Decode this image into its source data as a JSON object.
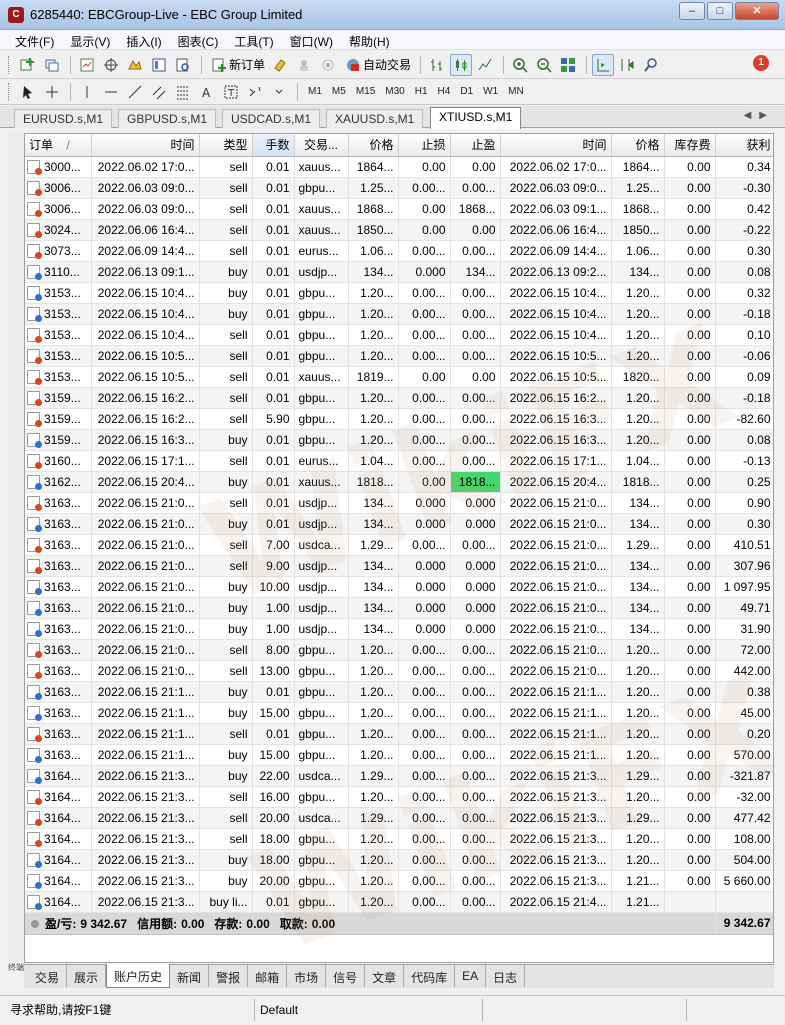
{
  "window": {
    "title": "6285440: EBCGroup-Live - EBC Group Limited",
    "app_icon": "mt4-icon",
    "controls": [
      "minimize",
      "maximize",
      "close"
    ]
  },
  "menu": [
    "文件(F)",
    "显示(V)",
    "插入(I)",
    "图表(C)",
    "工具(T)",
    "窗口(W)",
    "帮助(H)"
  ],
  "toolbar": {
    "new_order_label": "新订单",
    "auto_trade_label": "自动交易",
    "notification_count": "1",
    "timeframes": [
      "M1",
      "M5",
      "M15",
      "M30",
      "H1",
      "H4",
      "D1",
      "W1",
      "MN"
    ]
  },
  "chart_tabs": [
    {
      "label": "EURUSD.s,M1",
      "active": false
    },
    {
      "label": "GBPUSD.s,M1",
      "active": false
    },
    {
      "label": "USDCAD.s,M1",
      "active": false
    },
    {
      "label": "XAUUSD.s,M1",
      "active": false
    },
    {
      "label": "XTIUSD.s,M1",
      "active": true
    }
  ],
  "table": {
    "headers": [
      "订单",
      "/",
      "时间",
      "类型",
      "手数",
      "交易...",
      "价格",
      "止损",
      "止盈",
      "时间",
      "价格",
      "库存费",
      "获利"
    ],
    "rows": [
      [
        "3000...",
        "2022.06.02 17:0...",
        "sell",
        "0.01",
        "xauus...",
        "1864...",
        "0.00",
        "0.00",
        "2022.06.02 17:0...",
        "1864...",
        "0.00",
        "0.34"
      ],
      [
        "3006...",
        "2022.06.03 09:0...",
        "sell",
        "0.01",
        "gbpu...",
        "1.25...",
        "0.00...",
        "0.00...",
        "2022.06.03 09:0...",
        "1.25...",
        "0.00",
        "-0.30"
      ],
      [
        "3006...",
        "2022.06.03 09:0...",
        "sell",
        "0.01",
        "xauus...",
        "1868...",
        "0.00",
        "1868...",
        "2022.06.03 09:1...",
        "1868...",
        "0.00",
        "0.42"
      ],
      [
        "3024...",
        "2022.06.06 16:4...",
        "sell",
        "0.01",
        "xauus...",
        "1850...",
        "0.00",
        "0.00",
        "2022.06.06 16:4...",
        "1850...",
        "0.00",
        "-0.22"
      ],
      [
        "3073...",
        "2022.06.09 14:4...",
        "sell",
        "0.01",
        "eurus...",
        "1.06...",
        "0.00...",
        "0.00...",
        "2022.06.09 14:4...",
        "1.06...",
        "0.00",
        "0.30"
      ],
      [
        "3110...",
        "2022.06.13 09:1...",
        "buy",
        "0.01",
        "usdjp...",
        "134...",
        "0.000",
        "134...",
        "2022.06.13 09:2...",
        "134...",
        "0.00",
        "0.08"
      ],
      [
        "3153...",
        "2022.06.15 10:4...",
        "buy",
        "0.01",
        "gbpu...",
        "1.20...",
        "0.00...",
        "0.00...",
        "2022.06.15 10:4...",
        "1.20...",
        "0.00",
        "0.32"
      ],
      [
        "3153...",
        "2022.06.15 10:4...",
        "buy",
        "0.01",
        "gbpu...",
        "1.20...",
        "0.00...",
        "0.00...",
        "2022.06.15 10:4...",
        "1.20...",
        "0.00",
        "-0.18"
      ],
      [
        "3153...",
        "2022.06.15 10:4...",
        "sell",
        "0.01",
        "gbpu...",
        "1.20...",
        "0.00...",
        "0.00...",
        "2022.06.15 10:4...",
        "1.20...",
        "0.00",
        "0.10"
      ],
      [
        "3153...",
        "2022.06.15 10:5...",
        "sell",
        "0.01",
        "gbpu...",
        "1.20...",
        "0.00...",
        "0.00...",
        "2022.06.15 10:5...",
        "1.20...",
        "0.00",
        "-0.06"
      ],
      [
        "3153...",
        "2022.06.15 10:5...",
        "sell",
        "0.01",
        "xauus...",
        "1819...",
        "0.00",
        "0.00",
        "2022.06.15 10:5...",
        "1820...",
        "0.00",
        "0.09"
      ],
      [
        "3159...",
        "2022.06.15 16:2...",
        "sell",
        "0.01",
        "gbpu...",
        "1.20...",
        "0.00...",
        "0.00...",
        "2022.06.15 16:2...",
        "1.20...",
        "0.00",
        "-0.18"
      ],
      [
        "3159...",
        "2022.06.15 16:2...",
        "sell",
        "5.90",
        "gbpu...",
        "1.20...",
        "0.00...",
        "0.00...",
        "2022.06.15 16:3...",
        "1.20...",
        "0.00",
        "-82.60"
      ],
      [
        "3159...",
        "2022.06.15 16:3...",
        "buy",
        "0.01",
        "gbpu...",
        "1.20...",
        "0.00...",
        "0.00...",
        "2022.06.15 16:3...",
        "1.20...",
        "0.00",
        "0.08"
      ],
      [
        "3160...",
        "2022.06.15 17:1...",
        "sell",
        "0.01",
        "eurus...",
        "1.04...",
        "0.00...",
        "0.00...",
        "2022.06.15 17:1...",
        "1.04...",
        "0.00",
        "-0.13"
      ],
      [
        "3162...",
        "2022.06.15 20:4...",
        "buy",
        "0.01",
        "xauus...",
        "1818...",
        "0.00",
        "1818...",
        "2022.06.15 20:4...",
        "1818...",
        "0.00",
        "0.25"
      ],
      [
        "3163...",
        "2022.06.15 21:0...",
        "sell",
        "0.01",
        "usdjp...",
        "134...",
        "0.000",
        "0.000",
        "2022.06.15 21:0...",
        "134...",
        "0.00",
        "0.90"
      ],
      [
        "3163...",
        "2022.06.15 21:0...",
        "buy",
        "0.01",
        "usdjp...",
        "134...",
        "0.000",
        "0.000",
        "2022.06.15 21:0...",
        "134...",
        "0.00",
        "0.30"
      ],
      [
        "3163...",
        "2022.06.15 21:0...",
        "sell",
        "7.00",
        "usdca...",
        "1.29...",
        "0.00...",
        "0.00...",
        "2022.06.15 21:0...",
        "1.29...",
        "0.00",
        "410.51"
      ],
      [
        "3163...",
        "2022.06.15 21:0...",
        "sell",
        "9.00",
        "usdjp...",
        "134...",
        "0.000",
        "0.000",
        "2022.06.15 21:0...",
        "134...",
        "0.00",
        "307.96"
      ],
      [
        "3163...",
        "2022.06.15 21:0...",
        "buy",
        "10.00",
        "usdjp...",
        "134...",
        "0.000",
        "0.000",
        "2022.06.15 21:0...",
        "134...",
        "0.00",
        "1 097.95"
      ],
      [
        "3163...",
        "2022.06.15 21:0...",
        "buy",
        "1.00",
        "usdjp...",
        "134...",
        "0.000",
        "0.000",
        "2022.06.15 21:0...",
        "134...",
        "0.00",
        "49.71"
      ],
      [
        "3163...",
        "2022.06.15 21:0...",
        "buy",
        "1.00",
        "usdjp...",
        "134...",
        "0.000",
        "0.000",
        "2022.06.15 21:0...",
        "134...",
        "0.00",
        "31.90"
      ],
      [
        "3163...",
        "2022.06.15 21:0...",
        "sell",
        "8.00",
        "gbpu...",
        "1.20...",
        "0.00...",
        "0.00...",
        "2022.06.15 21:0...",
        "1.20...",
        "0.00",
        "72.00"
      ],
      [
        "3163...",
        "2022.06.15 21:0...",
        "sell",
        "13.00",
        "gbpu...",
        "1.20...",
        "0.00...",
        "0.00...",
        "2022.06.15 21:0...",
        "1.20...",
        "0.00",
        "442.00"
      ],
      [
        "3163...",
        "2022.06.15 21:1...",
        "buy",
        "0.01",
        "gbpu...",
        "1.20...",
        "0.00...",
        "0.00...",
        "2022.06.15 21:1...",
        "1.20...",
        "0.00",
        "0.38"
      ],
      [
        "3163...",
        "2022.06.15 21:1...",
        "buy",
        "15.00",
        "gbpu...",
        "1.20...",
        "0.00...",
        "0.00...",
        "2022.06.15 21:1...",
        "1.20...",
        "0.00",
        "45.00"
      ],
      [
        "3163...",
        "2022.06.15 21:1...",
        "sell",
        "0.01",
        "gbpu...",
        "1.20...",
        "0.00...",
        "0.00...",
        "2022.06.15 21:1...",
        "1.20...",
        "0.00",
        "0.20"
      ],
      [
        "3163...",
        "2022.06.15 21:1...",
        "buy",
        "15.00",
        "gbpu...",
        "1.20...",
        "0.00...",
        "0.00...",
        "2022.06.15 21:1...",
        "1.20...",
        "0.00",
        "570.00"
      ],
      [
        "3164...",
        "2022.06.15 21:3...",
        "buy",
        "22.00",
        "usdca...",
        "1.29...",
        "0.00...",
        "0.00...",
        "2022.06.15 21:3...",
        "1.29...",
        "0.00",
        "-321.87"
      ],
      [
        "3164...",
        "2022.06.15 21:3...",
        "sell",
        "16.00",
        "gbpu...",
        "1.20...",
        "0.00...",
        "0.00...",
        "2022.06.15 21:3...",
        "1.20...",
        "0.00",
        "-32.00"
      ],
      [
        "3164...",
        "2022.06.15 21:3...",
        "sell",
        "20.00",
        "usdca...",
        "1.29...",
        "0.00...",
        "0.00...",
        "2022.06.15 21:3...",
        "1.29...",
        "0.00",
        "477.42"
      ],
      [
        "3164...",
        "2022.06.15 21:3...",
        "sell",
        "18.00",
        "gbpu...",
        "1.20...",
        "0.00...",
        "0.00...",
        "2022.06.15 21:3...",
        "1.20...",
        "0.00",
        "108.00"
      ],
      [
        "3164...",
        "2022.06.15 21:3...",
        "buy",
        "18.00",
        "gbpu...",
        "1.20...",
        "0.00...",
        "0.00...",
        "2022.06.15 21:3...",
        "1.20...",
        "0.00",
        "504.00"
      ],
      [
        "3164...",
        "2022.06.15 21:3...",
        "buy",
        "20.00",
        "gbpu...",
        "1.20...",
        "0.00...",
        "0.00...",
        "2022.06.15 21:3...",
        "1.21...",
        "0.00",
        "5 660.00"
      ],
      [
        "3164...",
        "2022.06.15 21:3...",
        "buy li...",
        "0.01",
        "gbpu...",
        "1.20...",
        "0.00...",
        "0.00...",
        "2022.06.15 21:4...",
        "1.21...",
        "",
        ""
      ]
    ],
    "highlight": {
      "row": 15,
      "col": 7,
      "color": "#44d66a"
    }
  },
  "summary": {
    "pnl_label": "盈/亏:",
    "pnl_value": "9 342.67",
    "credit_label": "信用额:",
    "credit_value": "0.00",
    "deposit_label": "存款:",
    "deposit_value": "0.00",
    "withdrawal_label": "取款:",
    "withdrawal_value": "0.00",
    "total": "9 342.67"
  },
  "terminal_label": "终端",
  "bottom_tabs": [
    {
      "label": "交易",
      "active": false
    },
    {
      "label": "展示",
      "active": false
    },
    {
      "label": "账户历史",
      "active": true
    },
    {
      "label": "新闻",
      "active": false
    },
    {
      "label": "警报",
      "active": false
    },
    {
      "label": "邮箱",
      "active": false
    },
    {
      "label": "市场",
      "active": false
    },
    {
      "label": "信号",
      "active": false
    },
    {
      "label": "文章",
      "active": false
    },
    {
      "label": "代码库",
      "active": false
    },
    {
      "label": "EA",
      "active": false
    },
    {
      "label": "日志",
      "active": false
    }
  ],
  "status": {
    "help_text": "寻求帮助,请按F1键",
    "profile": "Default"
  },
  "watermark": "WikiFX"
}
